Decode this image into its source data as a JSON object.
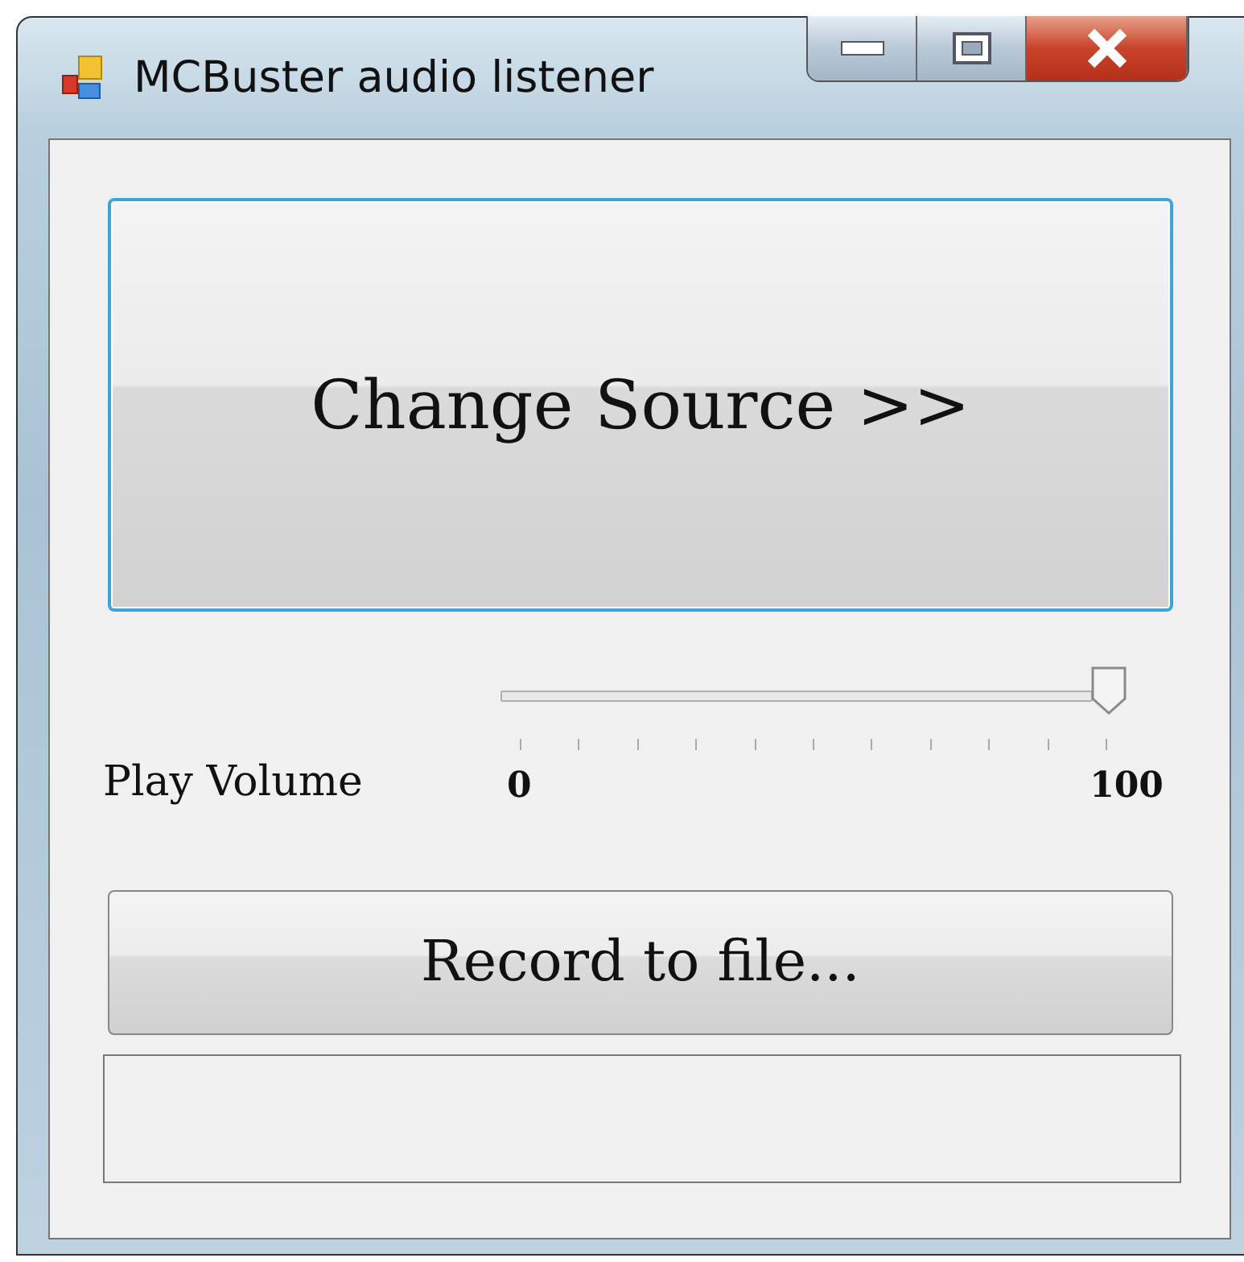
{
  "window": {
    "title": "MCBuster audio listener"
  },
  "source_button": {
    "label": "Change Source >>"
  },
  "volume": {
    "label": "Play Volume",
    "level": 1,
    "min_label": "0",
    "max_label": "100"
  },
  "record_button": {
    "label": "Record to file..."
  }
}
